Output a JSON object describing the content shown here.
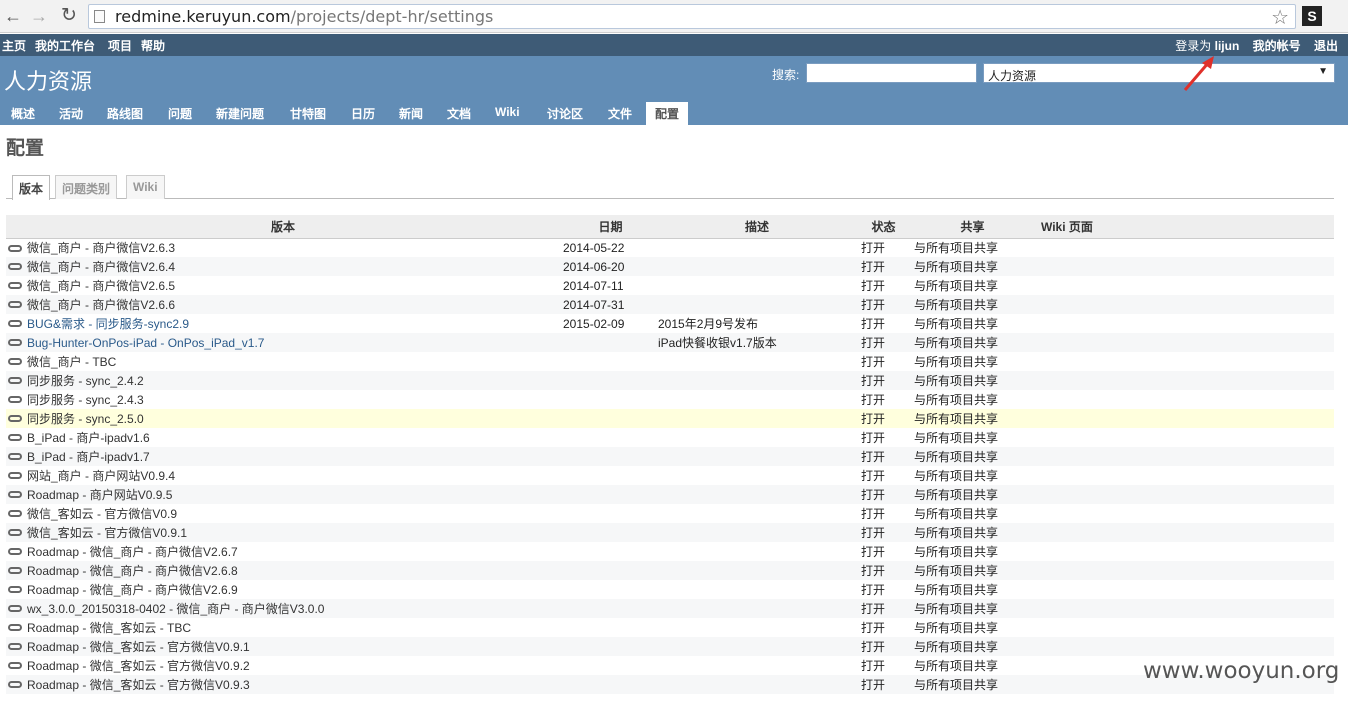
{
  "browser": {
    "url_host": "redmine.keruyun.com",
    "url_path": "/projects/dept-hr/settings",
    "ext_label": "S"
  },
  "top_menu": {
    "items": [
      "主页",
      "我的工作台",
      "项目",
      "帮助"
    ],
    "logged_as_prefix": "登录为",
    "username": "lijun",
    "my_account": "我的帐号",
    "logout": "退出"
  },
  "header": {
    "project_title": "人力资源",
    "search_label": "搜索:",
    "search_value": "",
    "project_select_value": "人力资源"
  },
  "main_menu": [
    "概述",
    "活动",
    "路线图",
    "问题",
    "新建问题",
    "甘特图",
    "日历",
    "新闻",
    "文档",
    "Wiki",
    "讨论区",
    "文件",
    "配置"
  ],
  "main_menu_selected": "配置",
  "page_title": "配置",
  "tabs": [
    "版本",
    "问题类别",
    "Wiki"
  ],
  "tabs_selected": "版本",
  "table": {
    "headers": [
      "版本",
      "日期",
      "描述",
      "状态",
      "共享",
      "Wiki 页面"
    ],
    "rows": [
      {
        "name": "微信_商户 - 商户微信V2.6.3",
        "date": "2014-05-22",
        "desc": "",
        "status": "打开",
        "share": "与所有项目共享",
        "wiki": ""
      },
      {
        "name": "微信_商户 - 商户微信V2.6.4",
        "date": "2014-06-20",
        "desc": "",
        "status": "打开",
        "share": "与所有项目共享",
        "wiki": ""
      },
      {
        "name": "微信_商户 - 商户微信V2.6.5",
        "date": "2014-07-11",
        "desc": "",
        "status": "打开",
        "share": "与所有项目共享",
        "wiki": ""
      },
      {
        "name": "微信_商户 - 商户微信V2.6.6",
        "date": "2014-07-31",
        "desc": "",
        "status": "打开",
        "share": "与所有项目共享",
        "wiki": ""
      },
      {
        "name": "BUG&需求 - 同步服务-sync2.9",
        "date": "2015-02-09",
        "desc": "2015年2月9号发布",
        "status": "打开",
        "share": "与所有项目共享",
        "wiki": ""
      },
      {
        "name": "Bug-Hunter-OnPos-iPad - OnPos_iPad_v1.7",
        "date": "",
        "desc": "iPad快餐收银v1.7版本",
        "status": "打开",
        "share": "与所有项目共享",
        "wiki": ""
      },
      {
        "name": "微信_商户 - TBC",
        "date": "",
        "desc": "",
        "status": "打开",
        "share": "与所有项目共享",
        "wiki": ""
      },
      {
        "name": "同步服务 - sync_2.4.2",
        "date": "",
        "desc": "",
        "status": "打开",
        "share": "与所有项目共享",
        "wiki": ""
      },
      {
        "name": "同步服务 - sync_2.4.3",
        "date": "",
        "desc": "",
        "status": "打开",
        "share": "与所有项目共享",
        "wiki": ""
      },
      {
        "name": "同步服务 - sync_2.5.0",
        "date": "",
        "desc": "",
        "status": "打开",
        "share": "与所有项目共享",
        "wiki": ""
      },
      {
        "name": "B_iPad - 商户-ipadv1.6",
        "date": "",
        "desc": "",
        "status": "打开",
        "share": "与所有项目共享",
        "wiki": ""
      },
      {
        "name": "B_iPad - 商户-ipadv1.7",
        "date": "",
        "desc": "",
        "status": "打开",
        "share": "与所有项目共享",
        "wiki": ""
      },
      {
        "name": "网站_商户 - 商户网站V0.9.4",
        "date": "",
        "desc": "",
        "status": "打开",
        "share": "与所有项目共享",
        "wiki": ""
      },
      {
        "name": "Roadmap - 商户网站V0.9.5",
        "date": "",
        "desc": "",
        "status": "打开",
        "share": "与所有项目共享",
        "wiki": ""
      },
      {
        "name": "微信_客如云 - 官方微信V0.9",
        "date": "",
        "desc": "",
        "status": "打开",
        "share": "与所有项目共享",
        "wiki": ""
      },
      {
        "name": "微信_客如云 - 官方微信V0.9.1",
        "date": "",
        "desc": "",
        "status": "打开",
        "share": "与所有项目共享",
        "wiki": ""
      },
      {
        "name": "Roadmap - 微信_商户 - 商户微信V2.6.7",
        "date": "",
        "desc": "",
        "status": "打开",
        "share": "与所有项目共享",
        "wiki": ""
      },
      {
        "name": "Roadmap - 微信_商户 - 商户微信V2.6.8",
        "date": "",
        "desc": "",
        "status": "打开",
        "share": "与所有项目共享",
        "wiki": ""
      },
      {
        "name": "Roadmap - 微信_商户 - 商户微信V2.6.9",
        "date": "",
        "desc": "",
        "status": "打开",
        "share": "与所有项目共享",
        "wiki": ""
      },
      {
        "name": "wx_3.0.0_20150318-0402 - 微信_商户 - 商户微信V3.0.0",
        "date": "",
        "desc": "",
        "status": "打开",
        "share": "与所有项目共享",
        "wiki": ""
      },
      {
        "name": "Roadmap - 微信_客如云 - TBC",
        "date": "",
        "desc": "",
        "status": "打开",
        "share": "与所有项目共享",
        "wiki": ""
      },
      {
        "name": "Roadmap - 微信_客如云 - 官方微信V0.9.1",
        "date": "",
        "desc": "",
        "status": "打开",
        "share": "与所有项目共享",
        "wiki": ""
      },
      {
        "name": "Roadmap - 微信_客如云 - 官方微信V0.9.2",
        "date": "",
        "desc": "",
        "status": "打开",
        "share": "与所有项目共享",
        "wiki": ""
      },
      {
        "name": "Roadmap - 微信_客如云 - 官方微信V0.9.3",
        "date": "",
        "desc": "",
        "status": "打开",
        "share": "与所有项目共享",
        "wiki": ""
      }
    ]
  },
  "watermark": "www.wooyun.org",
  "colors": {
    "top_menu_bg": "#3e5b76",
    "header_bg": "#628db6",
    "link_blue": "#2a5a8a",
    "highlight_row": "#ffffdd",
    "annotation_arrow": "#e0302a"
  }
}
